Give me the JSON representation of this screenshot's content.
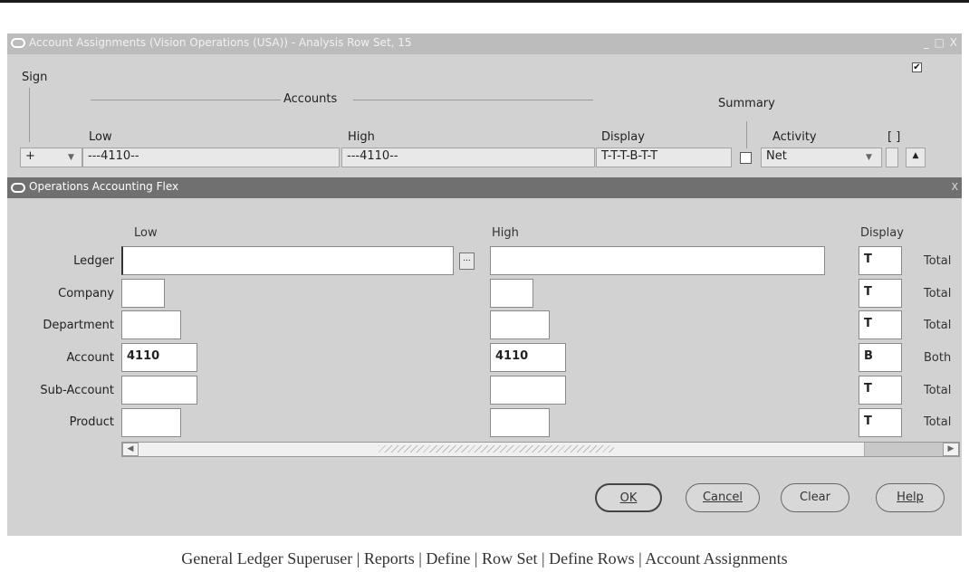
{
  "outer_window": {
    "title": "Account Assignments (Vision Operations (USA)) - Analysis Row Set, 15",
    "controls": "_ □ X",
    "sign_label": "Sign",
    "accounts_label": "Accounts",
    "summary_label": "Summary",
    "columns": {
      "low": "Low",
      "high": "High",
      "display": "Display",
      "activity": "Activity",
      "bracket": "[ ]"
    },
    "row": {
      "sign": "+",
      "low": "---4110--",
      "high": "---4110--",
      "display": "T-T-T-B-T-T",
      "activity": "Net"
    },
    "top_checkbox_checked": true
  },
  "flex_dialog": {
    "title": "Operations Accounting Flex",
    "close": "X",
    "headers": {
      "low": "Low",
      "high": "High",
      "display": "Display"
    },
    "segments": [
      {
        "label": "Ledger",
        "low": "",
        "high": "",
        "display": "T",
        "meaning": "Total"
      },
      {
        "label": "Company",
        "low": "",
        "high": "",
        "display": "T",
        "meaning": "Total"
      },
      {
        "label": "Department",
        "low": "",
        "high": "",
        "display": "T",
        "meaning": "Total"
      },
      {
        "label": "Account",
        "low": "4110",
        "high": "4110",
        "display": "B",
        "meaning": "Both"
      },
      {
        "label": "Sub-Account",
        "low": "",
        "high": "",
        "display": "T",
        "meaning": "Total"
      },
      {
        "label": "Product",
        "low": "",
        "high": "",
        "display": "T",
        "meaning": "Total"
      }
    ],
    "buttons": {
      "ok": "OK",
      "cancel": "Cancel",
      "clear": "Clear",
      "help": "Help"
    },
    "ellipsis": "..."
  },
  "caption": "General Ledger Superuser | Reports | Define | Row Set | Define Rows | Account Assignments"
}
